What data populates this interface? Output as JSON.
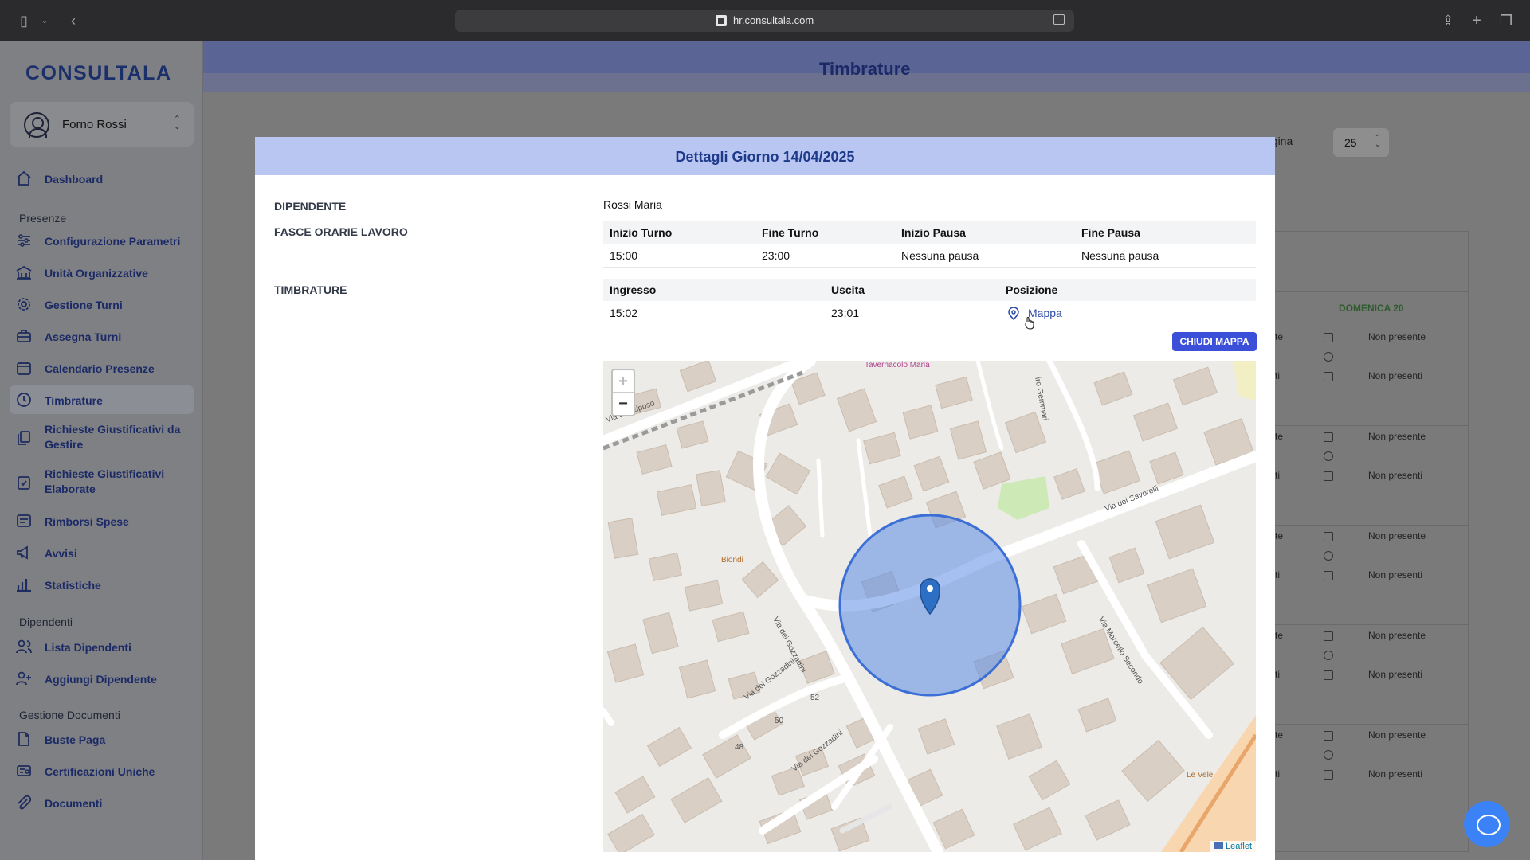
{
  "browser": {
    "url": "hr.consultala.com"
  },
  "sidebar": {
    "logo": "CONSULTALA",
    "user": "Forno Rossi",
    "items": [
      {
        "label": "Dashboard",
        "icon": "home-icon"
      },
      {
        "section": "Presenze"
      },
      {
        "label": "Configurazione Parametri",
        "icon": "sliders-icon"
      },
      {
        "label": "Unità Organizzative",
        "icon": "building-icon"
      },
      {
        "label": "Gestione Turni",
        "icon": "gear-icon"
      },
      {
        "label": "Assegna Turni",
        "icon": "briefcase-icon"
      },
      {
        "label": "Calendario Presenze",
        "icon": "calendar-icon"
      },
      {
        "label": "Timbrature",
        "icon": "clock-icon",
        "active": true
      },
      {
        "label": "Richieste Giustificativi da Gestire",
        "icon": "documents-icon"
      },
      {
        "label": "Richieste Giustificativi Elaborate",
        "icon": "clipboard-check-icon"
      },
      {
        "label": "Rimborsi Spese",
        "icon": "receipt-icon"
      },
      {
        "label": "Avvisi",
        "icon": "megaphone-icon"
      },
      {
        "label": "Statistiche",
        "icon": "bar-chart-icon"
      },
      {
        "section": "Dipendenti"
      },
      {
        "label": "Lista Dipendenti",
        "icon": "users-icon"
      },
      {
        "label": "Aggiungi Dipendente",
        "icon": "user-plus-icon"
      },
      {
        "section": "Gestione Documenti"
      },
      {
        "label": "Buste Paga",
        "icon": "document-icon"
      },
      {
        "label": "Certificazioni Uniche",
        "icon": "certificate-icon"
      },
      {
        "label": "Documenti",
        "icon": "paperclip-icon"
      }
    ]
  },
  "page": {
    "title": "Timbrature",
    "per_page_label": "agina",
    "per_page_value": "25",
    "day_header": "DOMENICA 20",
    "cell_texts": [
      "Non presente",
      "Non presenti"
    ],
    "partial_texts": [
      "te",
      "ti"
    ]
  },
  "modal": {
    "title": "Dettagli Giorno 14/04/2025",
    "employee_label": "DIPENDENTE",
    "employee_value": "Rossi Maria",
    "shifts_label": "FASCE ORARIE LAVORO",
    "shifts_headers": [
      "Inizio Turno",
      "Fine Turno",
      "Inizio Pausa",
      "Fine Pausa"
    ],
    "shifts_row": [
      "15:00",
      "23:00",
      "Nessuna pausa",
      "Nessuna pausa"
    ],
    "stamps_label": "TIMBRATURE",
    "stamps_headers": [
      "Ingresso",
      "Uscita",
      "Posizione"
    ],
    "stamps_row": [
      "15:02",
      "23:01",
      "Mappa"
    ],
    "close_map_label": "CHIUDI MAPPA"
  },
  "map": {
    "zoom_in": "+",
    "zoom_out": "−",
    "attribution": "Leaflet",
    "street_labels": [
      "Via del Riposo",
      "Via dei Savorelli",
      "Via Marcello Secondo",
      "Via dei Gozzadini",
      "Via dei Gozzadini",
      "Via dei Gozzadini",
      "iro Gemmari"
    ],
    "poi_labels": [
      "Biondi",
      "Le Vele",
      "Tavernacolo Maria"
    ],
    "house_numbers": [
      "52",
      "50",
      "48"
    ]
  }
}
